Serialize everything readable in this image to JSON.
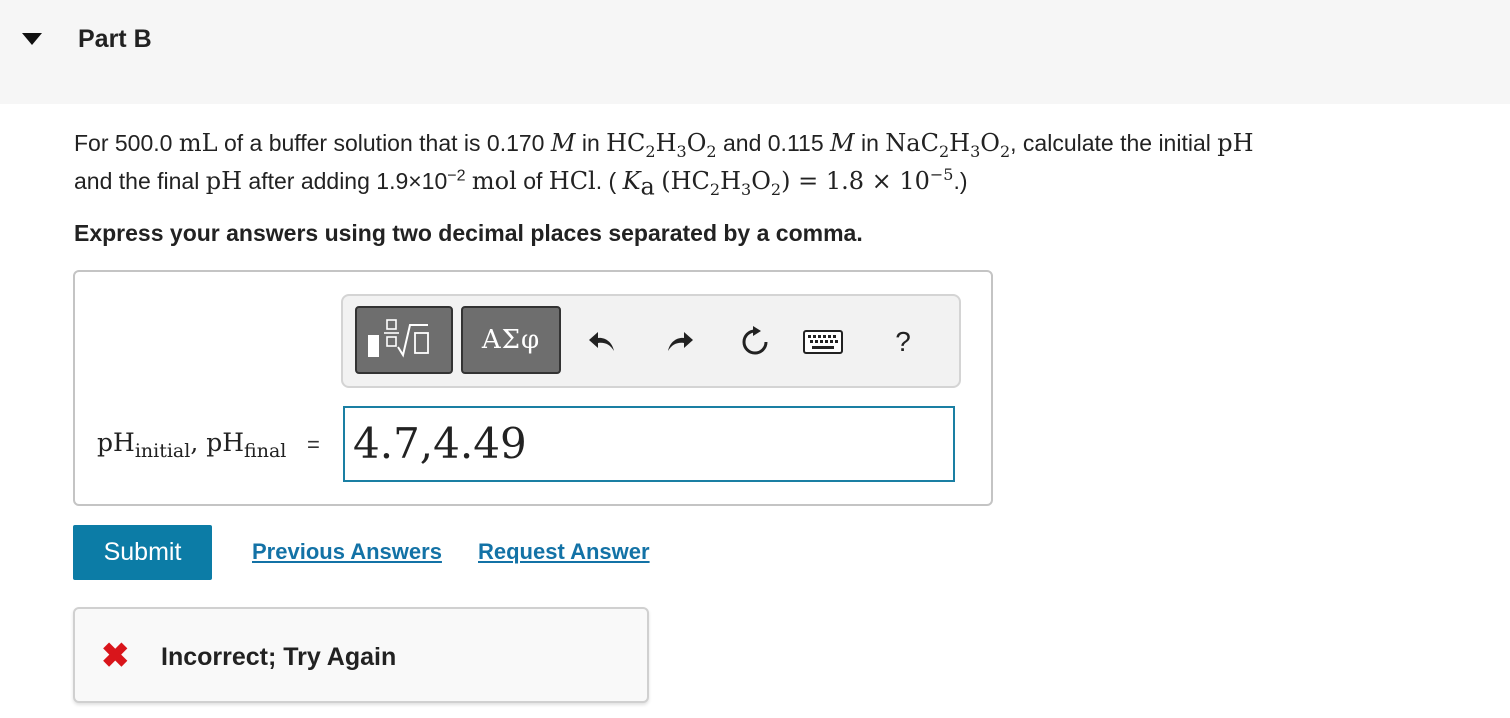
{
  "header": {
    "title": "Part B",
    "collapse_icon": "caret-down-icon"
  },
  "question": {
    "p1": "For 500.0",
    "p1_unit": "mL",
    "p2": "of a buffer solution that is 0.170",
    "p2_M": "M",
    "p3": "in",
    "acid": "HC",
    "acid_s1": "2",
    "acid_H": "H",
    "acid_s2": "3",
    "acid_O": "O",
    "acid_s3": "2",
    "p4": "and 0.115",
    "p4_M": "M",
    "p5": "in",
    "salt": "NaC",
    "salt_s1": "2",
    "salt_H": "H",
    "salt_s2": "3",
    "salt_O": "O",
    "salt_s3": "2",
    "p6": ", calculate the initial",
    "p6_pH": "pH",
    "p7": "and the final",
    "p7_pH": "pH",
    "p8": "after adding 1.9×10",
    "p8_exp": "−2",
    "p8_mol": "mol",
    "p9": "of",
    "hcl": "HCl",
    "p10": ". (",
    "ka_K": "K",
    "ka_sub": "a",
    "ka_open": "(HC",
    "ka_s1": "2",
    "ka_H": "H",
    "ka_s2": "3",
    "ka_O": "O",
    "ka_s3": "2",
    "ka_close": ")",
    "ka_value": "= 1.8 × 10",
    "ka_exp": "−5",
    "p11": ".)"
  },
  "instruction": "Express your answers using two decimal places separated by a comma.",
  "toolbar": {
    "template_icon": "fraction-radical-template-icon",
    "greek_label": "ΑΣφ",
    "undo_icon": "undo-icon",
    "redo_icon": "redo-icon",
    "reset_icon": "reset-icon",
    "keyboard_icon": "keyboard-icon",
    "help_label": "?"
  },
  "answer": {
    "label_pH1": "pH",
    "label_sub1": "initial",
    "label_sep": ", ",
    "label_pH2": "pH",
    "label_sub2": "final",
    "equals": "=",
    "value": "4.7,4.49"
  },
  "actions": {
    "submit_label": "Submit",
    "previous_label": "Previous Answers",
    "request_label": "Request Answer"
  },
  "feedback": {
    "icon": "x-mark-icon",
    "symbol": "✖",
    "message": "Incorrect; Try Again",
    "color": "#d9151b"
  },
  "colors": {
    "accent": "#0c7ca6",
    "link": "#1372a6",
    "input_border": "#1a7fa3"
  }
}
